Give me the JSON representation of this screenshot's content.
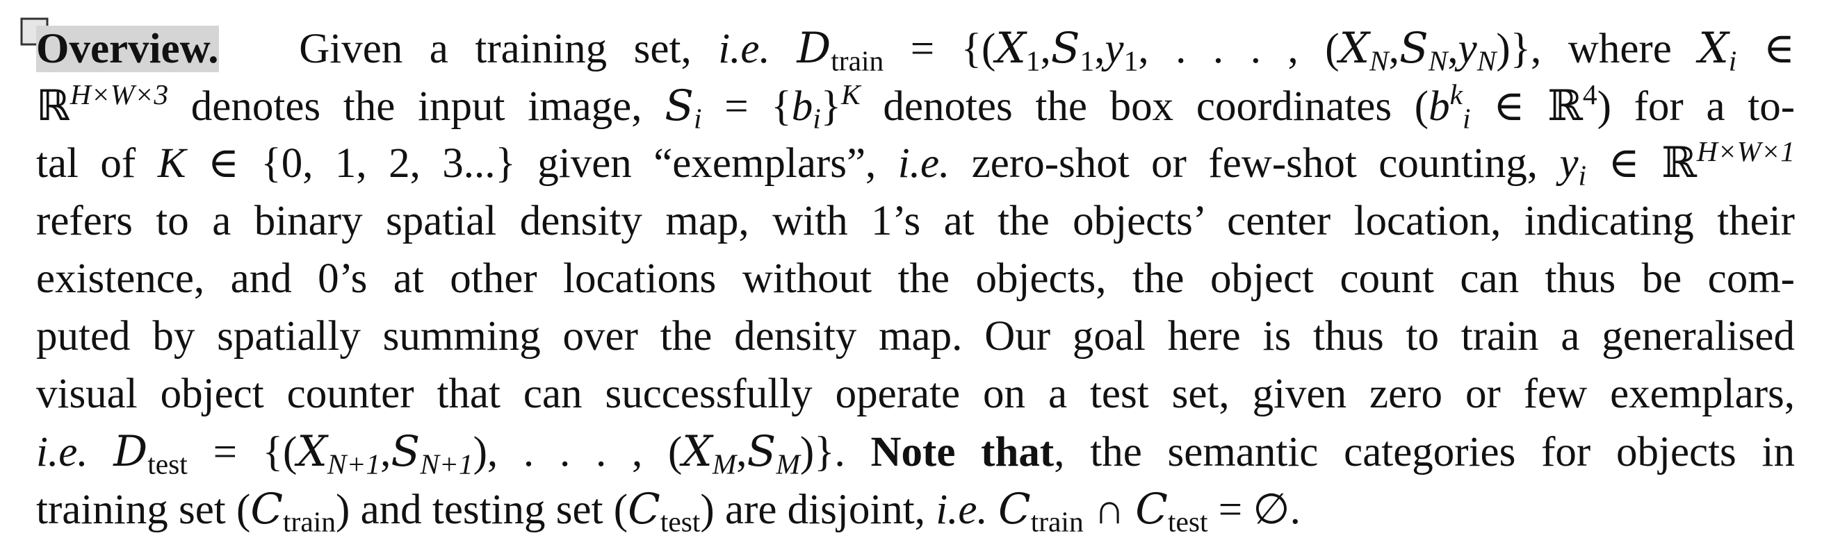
{
  "heading": "Overview.",
  "text": {
    "l1_a": "Given a training set, ",
    "ie": "i.e.",
    "l1_b": " ",
    "D": "D",
    "train": "train",
    "l1_c": " = {(",
    "X": "X",
    "S": "S",
    "y": "y",
    "one": "1",
    "N": "N",
    "comma": ",",
    "l1_d": ", . . . , (",
    "l1_e": ")}, where ",
    "i": "i",
    "in": " ∈",
    "R": "ℝ",
    "HW3": "H×W×3",
    "l2_a": " denotes the input image, ",
    "l2_b": " = {",
    "b": "b",
    "l2_c": "}",
    "Ksup": "K",
    "l2_d": " denotes the box coordinates (",
    "k": "k",
    "l2_e": " ∈ ℝ",
    "four": "4",
    "l2_f": ") for a to-",
    "l3_a": "tal of ",
    "K": "K",
    "l3_b": " ∈ {0, 1, 2, 3...} given “exemplars”, ",
    "l3_c": " zero-shot or few-shot counting, ",
    "l3_d": " ∈ ℝ",
    "HW1": "H×W×1",
    "l4": "refers to a binary spatial density map, with 1’s at the objects’ center location, indicating their",
    "l5": "existence, and 0’s at other locations without the objects, the object count can thus be com-",
    "l6": "puted by spatially summing over the density map. Our goal here is thus to train a generalised",
    "l7": "visual object counter that can successfully operate on a test set, given zero or few exemplars,",
    "test": "test",
    "l8_a": " = {(",
    "N1": "N+1",
    "l8_b": "), . . . , (",
    "M": "M",
    "l8_c": ")}. ",
    "note": "Note that",
    "l8_d": ", the semantic categories for objects in",
    "l9_a": "training set (",
    "C": "C",
    "l9_b": ") and testing set (",
    "l9_c": ") are disjoint, ",
    "l9_d": " ",
    "cap": " ∩ ",
    "l9_e": " = ∅."
  }
}
